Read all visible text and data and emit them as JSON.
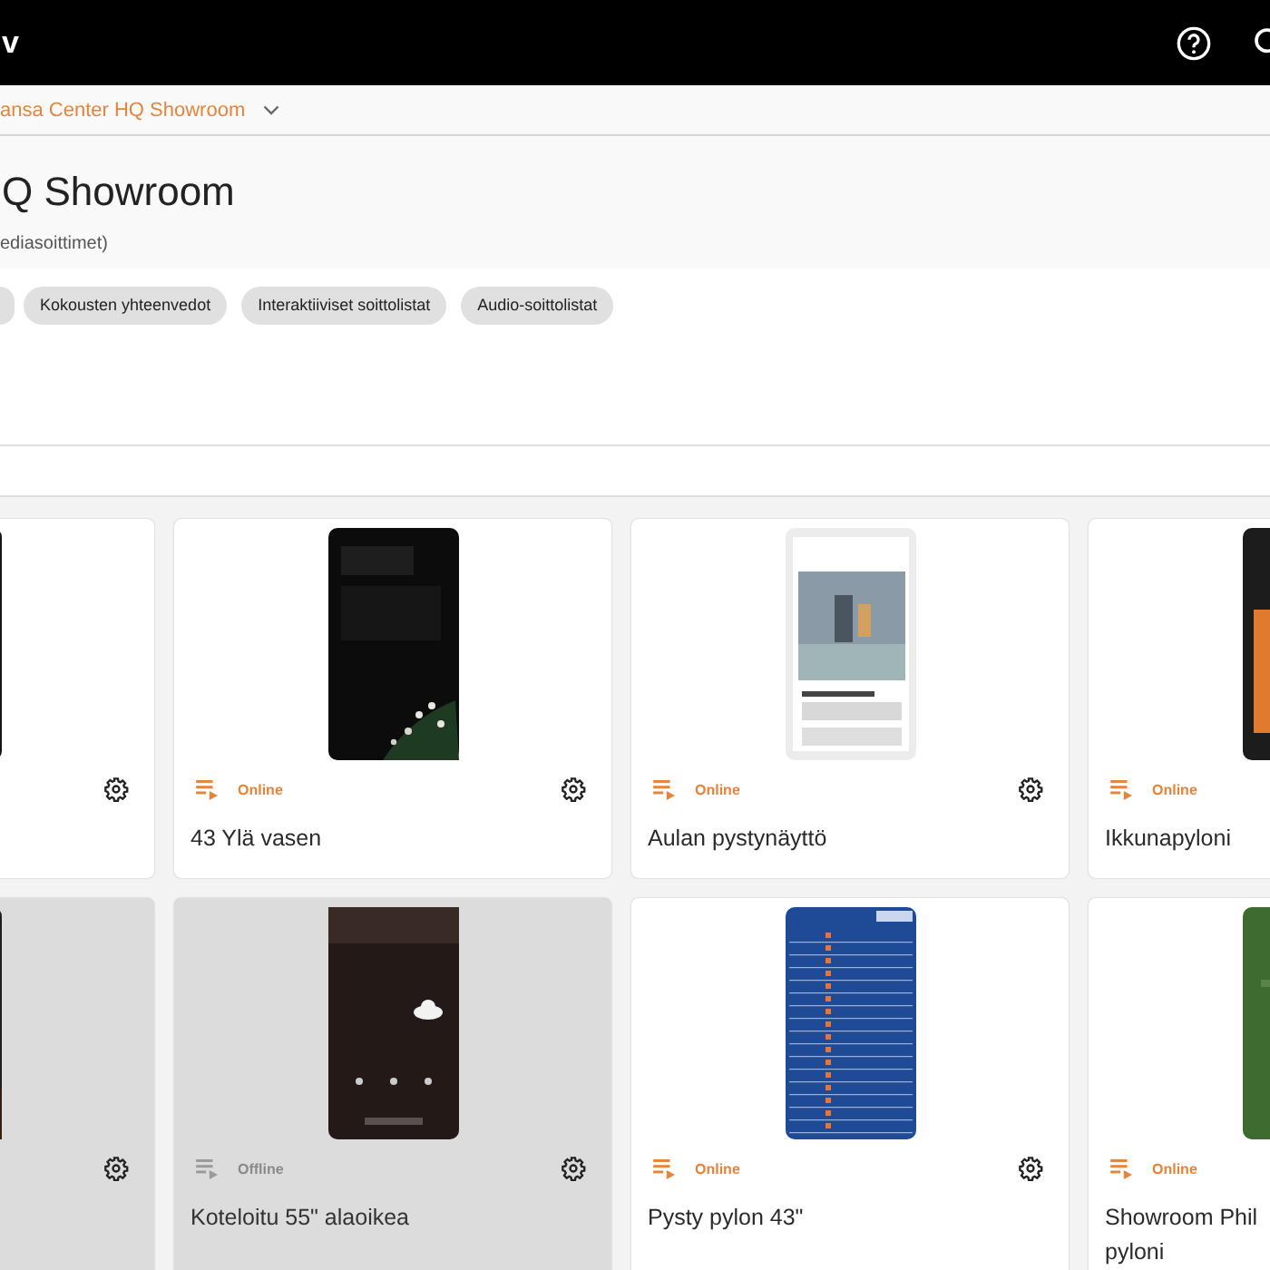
{
  "top_bar": {
    "logo_text": "v"
  },
  "breadcrumb": {
    "label": "ansa Center HQ Showroom"
  },
  "header": {
    "title": "Q Showroom",
    "subtitle": "ediasoittimet)"
  },
  "filter_chips": [
    "Kokousten yhteenvedot",
    "Interaktiiviset soittolistat",
    "Audio-soittolistat"
  ],
  "devices": [
    {
      "online": true
    },
    {
      "name": "43 Ylä vasen",
      "status": "Online",
      "online": true
    },
    {
      "name": "Aulan pystynäyttö",
      "status": "Online",
      "online": true
    },
    {
      "name": "Ikkunapyloni",
      "status": "Online",
      "online": true
    },
    {
      "online": false
    },
    {
      "name": "Koteloitu 55\" alaoikea",
      "status": "Offline",
      "online": false
    },
    {
      "name": "Pysty pylon 43\"",
      "status": "Online",
      "online": true
    },
    {
      "name": "Showroom Phil\npyloni",
      "status": "Online",
      "online": true
    }
  ]
}
